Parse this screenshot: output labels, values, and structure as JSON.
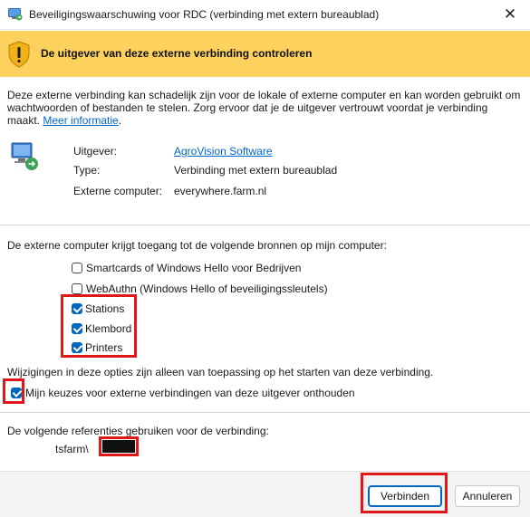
{
  "window": {
    "title": "Beveiligingswaarschuwing voor RDC (verbinding met extern bureaublad)",
    "close_glyph": "✕"
  },
  "banner": {
    "text": "De uitgever van deze externe verbinding controleren",
    "color": "#fcd15e"
  },
  "intro": {
    "text": "Deze externe verbinding kan schadelijk zijn voor de lokale of externe computer en kan worden gebruikt om wachtwoorden of bestanden te stelen. Zorg ervoor dat je de uitgever vertrouwt voordat je verbinding maakt. ",
    "link": "Meer informatie",
    "link_suffix": "."
  },
  "info": {
    "publisher_label": "Uitgever:",
    "publisher_value": "AgroVision Software",
    "type_label": "Type:",
    "type_value": "Verbinding met extern bureaublad",
    "remote_label": "Externe computer:",
    "remote_value": "everywhere.farm.nl"
  },
  "resources": {
    "heading": "De externe computer krijgt toegang tot de volgende bronnen op mijn computer:",
    "items": [
      {
        "label": "Smartcards of Windows Hello voor Bedrijven",
        "checked": false
      },
      {
        "label": "WebAuthn (Windows Hello of beveiligingssleutels)",
        "checked": false
      },
      {
        "label": "Stations",
        "checked": true
      },
      {
        "label": "Klembord",
        "checked": true
      },
      {
        "label": "Printers",
        "checked": true
      }
    ]
  },
  "notice": "Wijzigingen in deze opties zijn alleen van toepassing op het starten van deze verbinding.",
  "remember": {
    "label": "Mijn keuzes voor externe verbindingen van deze uitgever onthouden",
    "checked": true
  },
  "credentials": {
    "heading": "De volgende referenties gebruiken voor de verbinding:",
    "user_prefix": "tsfarm\\"
  },
  "buttons": {
    "connect": "Verbinden",
    "cancel": "Annuleren"
  },
  "colors": {
    "accent": "#0067c0",
    "highlight": "#e01818",
    "link": "#0066cc"
  }
}
